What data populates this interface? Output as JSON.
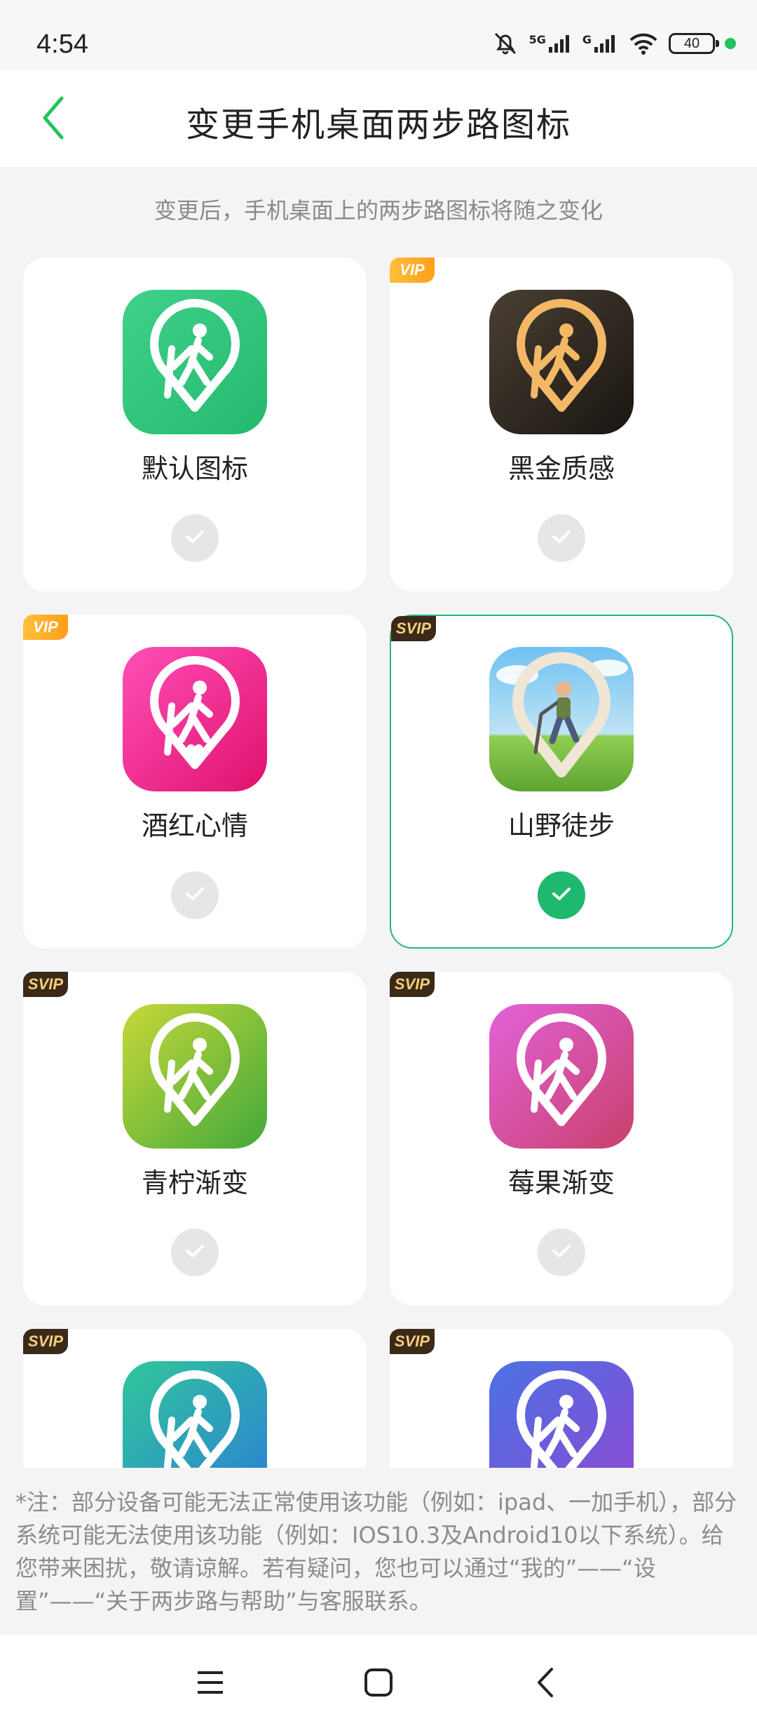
{
  "status_bar": {
    "time": "4:54",
    "battery": "40",
    "network1": "5G",
    "network2": "G"
  },
  "header": {
    "title": "变更手机桌面两步路图标"
  },
  "subtitle": "变更后，手机桌面上的两步路图标将随之变化",
  "icons": [
    {
      "label": "默认图标",
      "badge": "",
      "selected": false,
      "colors": [
        "#3fd18a",
        "#25b96e"
      ]
    },
    {
      "label": "黑金质感",
      "badge": "VIP",
      "selected": false,
      "colors": [
        "#4a3f33",
        "#1a1612"
      ]
    },
    {
      "label": "酒红心情",
      "badge": "VIP",
      "selected": false,
      "colors": [
        "#ff4fb8",
        "#e0126d"
      ]
    },
    {
      "label": "山野徒步",
      "badge": "SVIP",
      "selected": true,
      "colors": [
        "#6fc1f2",
        "#7dbb43"
      ]
    },
    {
      "label": "青柠渐变",
      "badge": "SVIP",
      "selected": false,
      "colors": [
        "#c7d83a",
        "#42a83a"
      ]
    },
    {
      "label": "莓果渐变",
      "badge": "SVIP",
      "selected": false,
      "colors": [
        "#e361d9",
        "#c8416b"
      ]
    },
    {
      "label": "",
      "badge": "SVIP",
      "selected": false,
      "colors": [
        "#31c79a",
        "#2b7fd6"
      ]
    },
    {
      "label": "",
      "badge": "SVIP",
      "selected": false,
      "colors": [
        "#4a73e4",
        "#8f47d3"
      ]
    }
  ],
  "note": "*注：部分设备可能无法正常使用该功能（例如：ipad、一加手机），部分系统可能无法使用该功能（例如：IOS10.3及Android10以下系统）。给您带来困扰，敬请谅解。若有疑问，您也可以通过“我的”——“设置”——“关于两步路与帮助”与客服联系。",
  "theme": {
    "accent": "#22b77a",
    "back_arrow": "#23c25f"
  }
}
